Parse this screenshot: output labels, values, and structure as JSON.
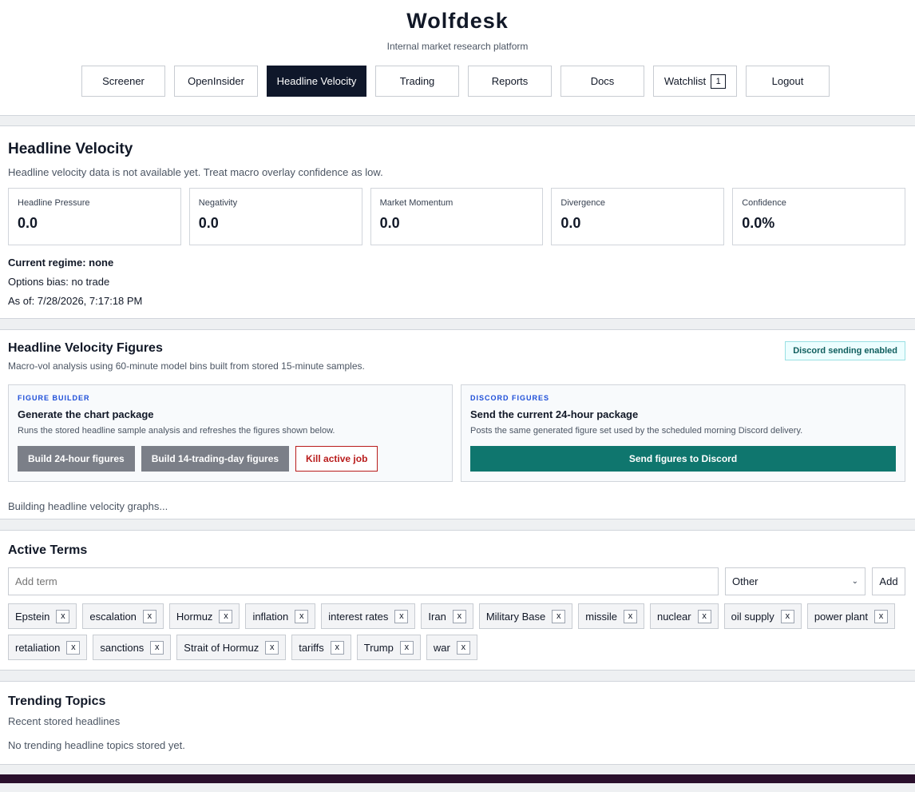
{
  "header": {
    "brand": "Wolfdesk",
    "tagline": "Internal market research platform",
    "nav": [
      {
        "label": "Screener",
        "active": false
      },
      {
        "label": "OpenInsider",
        "active": false
      },
      {
        "label": "Headline Velocity",
        "active": true
      },
      {
        "label": "Trading",
        "active": false
      },
      {
        "label": "Reports",
        "active": false
      },
      {
        "label": "Docs",
        "active": false
      },
      {
        "label": "Watchlist",
        "active": false,
        "count": "1"
      },
      {
        "label": "Logout",
        "active": false
      }
    ]
  },
  "velocity": {
    "title": "Headline Velocity",
    "notice": "Headline velocity data is not available yet. Treat macro overlay confidence as low.",
    "metrics": [
      {
        "label": "Headline Pressure",
        "value": "0.0"
      },
      {
        "label": "Negativity",
        "value": "0.0"
      },
      {
        "label": "Market Momentum",
        "value": "0.0"
      },
      {
        "label": "Divergence",
        "value": "0.0"
      },
      {
        "label": "Confidence",
        "value": "0.0%"
      }
    ],
    "regime": "Current regime: none",
    "options_bias": "Options bias: no trade",
    "as_of": "As of: 7/28/2026, 7:17:18 PM"
  },
  "figures": {
    "title": "Headline Velocity Figures",
    "subtitle": "Macro-vol analysis using 60-minute model bins built from stored 15-minute samples.",
    "discord_badge": "Discord sending enabled",
    "builder": {
      "kicker": "FIGURE BUILDER",
      "title": "Generate the chart package",
      "desc": "Runs the stored headline sample analysis and refreshes the figures shown below.",
      "btn_24h": "Build 24-hour figures",
      "btn_14d": "Build 14-trading-day figures",
      "btn_kill": "Kill active job"
    },
    "discord": {
      "kicker": "DISCORD FIGURES",
      "title": "Send the current 24-hour package",
      "desc": "Posts the same generated figure set used by the scheduled morning Discord delivery.",
      "btn_send": "Send figures to Discord"
    },
    "status": "Building headline velocity graphs..."
  },
  "terms": {
    "title": "Active Terms",
    "placeholder": "Add term",
    "category": "Other",
    "add_label": "Add",
    "remove_label": "x",
    "items": [
      "Epstein",
      "escalation",
      "Hormuz",
      "inflation",
      "interest rates",
      "Iran",
      "Military Base",
      "missile",
      "nuclear",
      "oil supply",
      "power plant",
      "retaliation",
      "sanctions",
      "Strait of Hormuz",
      "tariffs",
      "Trump",
      "war"
    ]
  },
  "trending": {
    "title": "Trending Topics",
    "subtitle": "Recent stored headlines",
    "empty": "No trending headline topics stored yet."
  },
  "colors": {
    "nav_active": "#0f172a",
    "teal": "#0f766e",
    "danger": "#b91c1c",
    "kicker": "#1d4ed8",
    "footer": "#2a0f2c"
  }
}
